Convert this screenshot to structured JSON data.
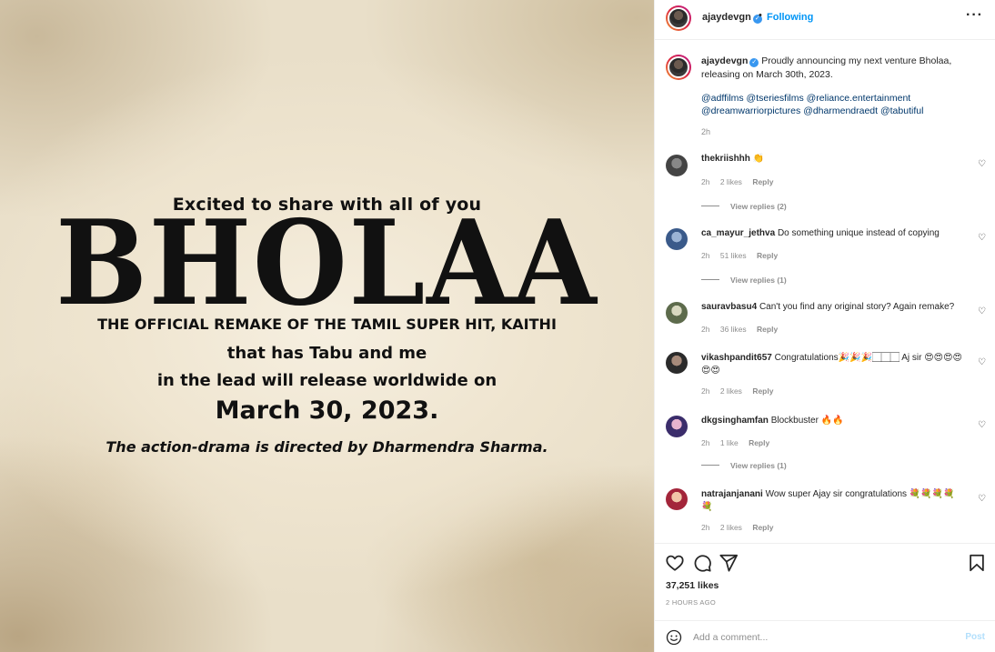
{
  "poster": {
    "excited": "Excited to share with all of you",
    "title": "BHOLAA",
    "remake": "THE OFFICIAL REMAKE OF THE TAMIL SUPER HIT, KAITHI",
    "tabu": "that has Tabu and me",
    "lead": "in the lead will release worldwide on",
    "date": "March 30, 2023.",
    "director": "The action-drama is directed by Dharmendra Sharma."
  },
  "header": {
    "username": "ajaydevgn",
    "separator": "•",
    "follow_label": "Following",
    "more_label": "···"
  },
  "caption": {
    "username": "ajaydevgn",
    "text": "Proudly announcing my next venture Bholaa, releasing on March 30th, 2023.",
    "mentions": "@adffilms @tseriesfilms @reliance.entertainment @dreamwarriorpictures @dharmendraedt @tabutiful",
    "time": "2h"
  },
  "comments": [
    {
      "username": "thekriishhh",
      "text": "👏",
      "time": "2h",
      "likes": "2 likes",
      "reply": "Reply",
      "view_replies": "View replies (2)"
    },
    {
      "username": "ca_mayur_jethva",
      "text": "Do something unique instead of copying",
      "time": "2h",
      "likes": "51 likes",
      "reply": "Reply",
      "view_replies": "View replies (1)"
    },
    {
      "username": "sauravbasu4",
      "text": "Can't you find any original story? Again remake?",
      "time": "2h",
      "likes": "36 likes",
      "reply": "Reply"
    },
    {
      "username": "vikashpandit657",
      "text": "Congratulations🎉🎉🎉🏻🏻🏻 Aj sir 😍😍😍😍😍😍",
      "time": "2h",
      "likes": "2 likes",
      "reply": "Reply"
    },
    {
      "username": "dkgsinghamfan",
      "text": "Blockbuster 🔥🔥",
      "time": "2h",
      "likes": "1 like",
      "reply": "Reply",
      "view_replies": "View replies (1)"
    },
    {
      "username": "natrajanjanani",
      "text": "Wow super Ajay sir congratulations 💐💐💐💐💐",
      "time": "2h",
      "likes": "2 likes",
      "reply": "Reply"
    }
  ],
  "footer": {
    "likes": "37,251 likes",
    "ago": "2 HOURS AGO",
    "comment_placeholder": "Add a comment...",
    "post_label": "Post"
  },
  "colors": {
    "link": "#00376b",
    "follow": "#0095f6",
    "muted": "#8e8e8e",
    "post_disabled": "#b2dffc"
  }
}
